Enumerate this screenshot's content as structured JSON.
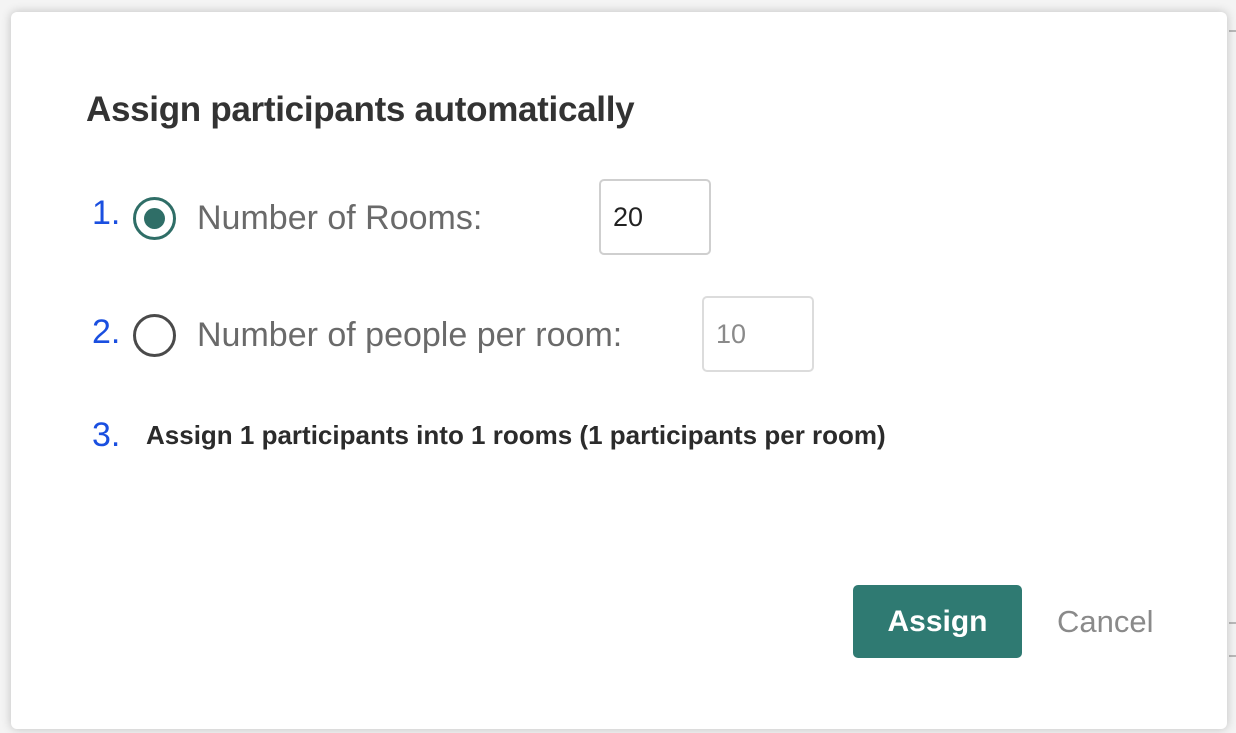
{
  "dialog": {
    "title": "Assign participants automatically",
    "options": [
      {
        "step": "1.",
        "label": "Number of Rooms:",
        "selected": true,
        "value": "20"
      },
      {
        "step": "2.",
        "label": "Number of people per room:",
        "selected": false,
        "value": "10"
      }
    ],
    "summary": {
      "step": "3.",
      "text": "Assign 1 participants into 1 rooms (1 participants per room)"
    },
    "buttons": {
      "assign_label": "Assign",
      "cancel_label": "Cancel"
    }
  },
  "colors": {
    "accent": "#2f7a72",
    "step_number": "#1a4fe0"
  }
}
